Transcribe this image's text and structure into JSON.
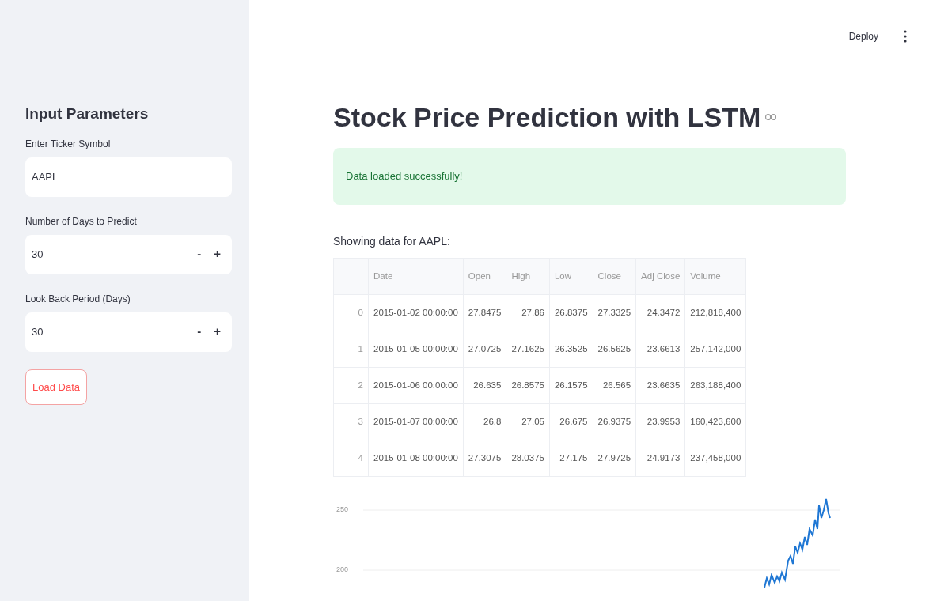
{
  "header": {
    "deploy": "Deploy"
  },
  "sidebar": {
    "title": "Input Parameters",
    "fields": [
      {
        "kind": "text",
        "label": "Enter Ticker Symbol",
        "value": "AAPL"
      },
      {
        "kind": "number",
        "label": "Number of Days to Predict",
        "value": "30",
        "decrement": "-",
        "increment": "+"
      },
      {
        "kind": "number",
        "label": "Look Back Period (Days)",
        "value": "30",
        "decrement": "-",
        "increment": "+"
      }
    ],
    "button": "Load Data"
  },
  "main": {
    "title": "Stock Price Prediction with LSTM",
    "alert": "Data loaded successfully!",
    "caption": "Showing data for AAPL:",
    "table": {
      "columns": [
        "",
        "Date",
        "Open",
        "High",
        "Low",
        "Close",
        "Adj Close",
        "Volume"
      ],
      "rows": [
        [
          "0",
          "2015-01-02 00:00:00",
          "27.8475",
          "27.86",
          "26.8375",
          "27.3325",
          "24.3472",
          "212,818,400"
        ],
        [
          "1",
          "2015-01-05 00:00:00",
          "27.0725",
          "27.1625",
          "26.3525",
          "26.5625",
          "23.6613",
          "257,142,000"
        ],
        [
          "2",
          "2015-01-06 00:00:00",
          "26.635",
          "26.8575",
          "26.1575",
          "26.565",
          "23.6635",
          "263,188,400"
        ],
        [
          "3",
          "2015-01-07 00:00:00",
          "26.8",
          "27.05",
          "26.675",
          "26.9375",
          "23.9953",
          "160,423,600"
        ],
        [
          "4",
          "2015-01-08 00:00:00",
          "27.3075",
          "28.0375",
          "27.175",
          "27.9725",
          "24.9173",
          "237,458,000"
        ]
      ]
    },
    "chart": {
      "y_tick_labels": [
        "250",
        "200"
      ]
    }
  }
}
